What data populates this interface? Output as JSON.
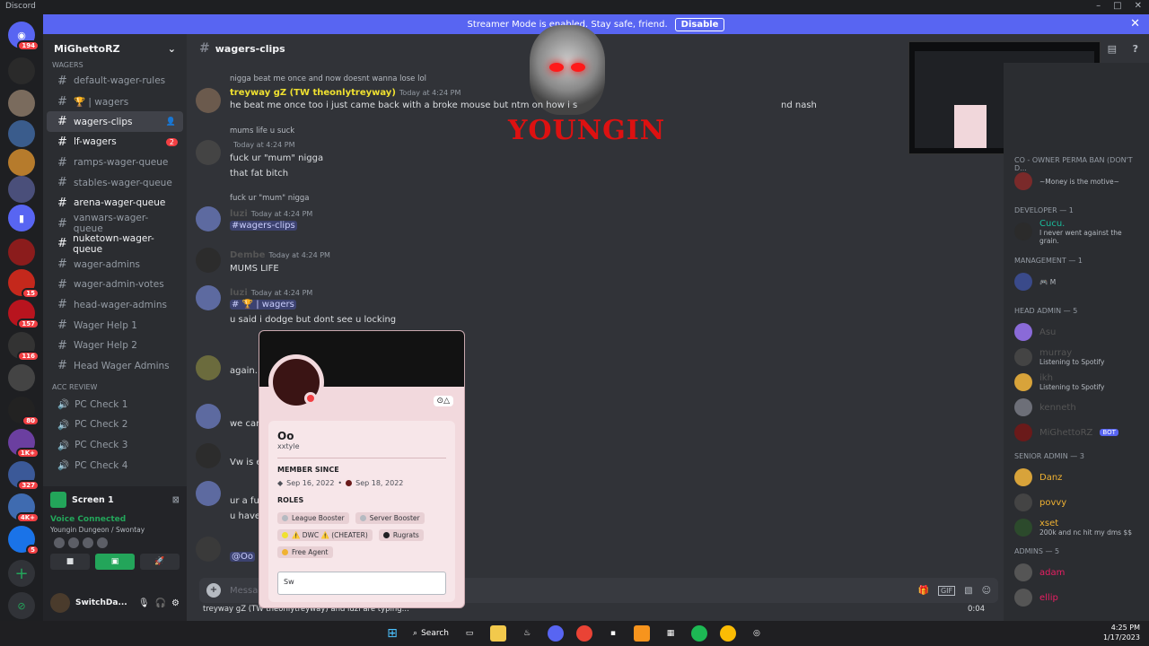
{
  "app_title": "Discord",
  "banner": {
    "text": "Streamer Mode is enabled. Stay safe, friend.",
    "button": "Disable"
  },
  "guild_badges": [
    "194",
    "15",
    "157",
    "116",
    "80",
    "1K+",
    "327",
    "4K+",
    "5"
  ],
  "server": {
    "name": "MiGhettoRZ"
  },
  "sidebar": {
    "cat_wagers": "WAGERS",
    "channels": [
      {
        "name": "default-wager-rules"
      },
      {
        "name": "🏆 | wagers"
      },
      {
        "name": "wagers-clips"
      },
      {
        "name": "lf-wagers",
        "badge": "2"
      },
      {
        "name": "ramps-wager-queue"
      },
      {
        "name": "stables-wager-queue"
      },
      {
        "name": "arena-wager-queue"
      },
      {
        "name": "vanwars-wager-queue"
      },
      {
        "name": "nuketown-wager-queue"
      },
      {
        "name": "wager-admins"
      },
      {
        "name": "wager-admin-votes"
      },
      {
        "name": "head-wager-admins"
      },
      {
        "name": "Wager Help 1"
      },
      {
        "name": "Wager Help 2"
      },
      {
        "name": "Head Wager Admins"
      }
    ],
    "cat_acc": "ACC REVIEW",
    "voice": [
      {
        "name": "PC Check 1"
      },
      {
        "name": "PC Check 2"
      },
      {
        "name": "PC Check 3"
      },
      {
        "name": "PC Check 4"
      }
    ],
    "screen": "Screen 1",
    "voice_connected": "Voice Connected",
    "voice_location": "Youngin Dungeon / Swontay",
    "username": "SwitchDa..."
  },
  "chat": {
    "channel": "wagers-clips",
    "messages": [
      {
        "reply": "nigga beat me once and now doesnt wanna lose lol",
        "name": "treyway gZ (TW theonlytreyway)",
        "time": "Today at 4:24 PM",
        "text": "he beat me once too i just came back with a broke mouse but ntm on how i s",
        "text2": "nd nash"
      },
      {
        "reply": "mums life u suck",
        "name": "",
        "time": "Today at 4:24 PM",
        "text": "fuck ur \"mum\" nigga",
        "text2": "that fat bitch"
      },
      {
        "reply": "fuck ur \"mum\" nigga",
        "name": "luzi",
        "time": "Today at 4:24 PM",
        "text": "#wagers-clips"
      },
      {
        "name": "Dembe",
        "time": "Today at 4:24 PM",
        "text": "MUMS LIFE"
      },
      {
        "name": "luzi",
        "time": "Today at 4:24 PM",
        "text": "# 🏆 | wagers",
        "text2": "u said i dodge but dont see u locking"
      },
      {
        "text": "again..."
      },
      {
        "text": "we can"
      },
      {
        "text": "Vw is e"
      },
      {
        "text": "ur a fu",
        "text2": "u have"
      },
      {
        "text": "@Oo"
      }
    ],
    "composer_placeholder": "Message #wagers-clips",
    "typing": "treyway gZ (TW theonlytreyway) and luzi are typing...",
    "clip_time": "0:04"
  },
  "members": {
    "groups": [
      {
        "role": "CO - OWNER PERMA BAN (DON'T D...",
        "members": [
          {
            "name": "",
            "status": "~Money is the motive~"
          }
        ]
      },
      {
        "role": "DEVELOPER — 1",
        "members": [
          {
            "name": "Cucu.",
            "status": "I never went against the grain."
          }
        ]
      },
      {
        "role": "MANAGEMENT — 1",
        "members": [
          {
            "name": "",
            "status": "🎮 M"
          }
        ]
      },
      {
        "role": "HEAD ADMIN — 5",
        "members": [
          {
            "name": "Asu",
            "status": ""
          },
          {
            "name": "murray",
            "status": "Listening to Spotify"
          },
          {
            "name": "ikh",
            "status": "Listening to Spotify"
          },
          {
            "name": "kenneth",
            "status": ""
          },
          {
            "name": "MiGhettoRZ",
            "status": "",
            "bot": "BOT"
          }
        ]
      },
      {
        "role": "SENIOR ADMIN — 3",
        "members": [
          {
            "name": "Danz",
            "status": ""
          },
          {
            "name": "povvy",
            "status": ""
          },
          {
            "name": "xset",
            "status": "200k and nc hit my dms $$"
          }
        ]
      },
      {
        "role": "ADMINS — 5",
        "members": [
          {
            "name": "adam",
            "status": ""
          },
          {
            "name": "ellip",
            "status": ""
          }
        ]
      }
    ]
  },
  "popout": {
    "display_name": "Oo",
    "username": "xxtyle",
    "member_since_label": "MEMBER SINCE",
    "date_discord": "Sep 16, 2022",
    "date_server": "Sep 18, 2022",
    "roles_label": "ROLES",
    "roles": [
      {
        "name": "League Booster",
        "color": "#b5bac1"
      },
      {
        "name": "Server Booster",
        "color": "#b5bac1"
      },
      {
        "name": "⚠️ DWC ⚠️ (CHEATER)",
        "color": "#f0e130"
      },
      {
        "name": "Rugrats",
        "color": "#1e1f22"
      },
      {
        "name": "Free Agent",
        "color": "#f0b232"
      }
    ],
    "note_value": "Sw"
  },
  "overlay": {
    "text": "YOUNGIN"
  },
  "taskbar": {
    "search": "Search",
    "time": "4:25 PM",
    "date": "1/17/2023"
  }
}
